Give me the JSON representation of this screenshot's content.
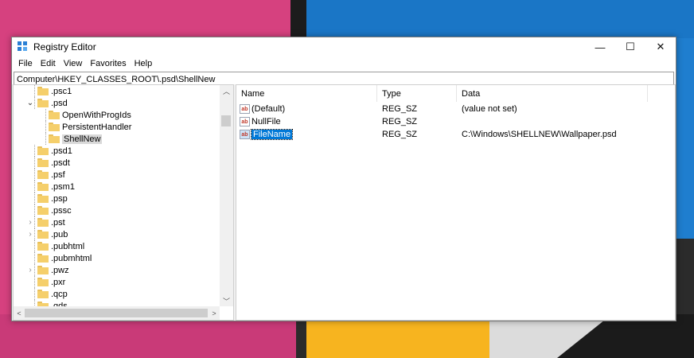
{
  "window": {
    "title": "Registry Editor",
    "controls": {
      "minimize": "—",
      "maximize": "☐",
      "close": "✕"
    }
  },
  "menu": [
    "File",
    "Edit",
    "View",
    "Favorites",
    "Help"
  ],
  "address": "Computer\\HKEY_CLASSES_ROOT\\.psd\\ShellNew",
  "tree": [
    {
      "label": ".psc1",
      "indent": 0,
      "expander": ""
    },
    {
      "label": ".psd",
      "indent": 0,
      "expander": "open"
    },
    {
      "label": "OpenWithProgIds",
      "indent": 1,
      "expander": ""
    },
    {
      "label": "PersistentHandler",
      "indent": 1,
      "expander": ""
    },
    {
      "label": "ShellNew",
      "indent": 1,
      "expander": "",
      "selected": true
    },
    {
      "label": ".psd1",
      "indent": 0,
      "expander": ""
    },
    {
      "label": ".psdt",
      "indent": 0,
      "expander": ""
    },
    {
      "label": ".psf",
      "indent": 0,
      "expander": ""
    },
    {
      "label": ".psm1",
      "indent": 0,
      "expander": ""
    },
    {
      "label": ".psp",
      "indent": 0,
      "expander": ""
    },
    {
      "label": ".pssc",
      "indent": 0,
      "expander": ""
    },
    {
      "label": ".pst",
      "indent": 0,
      "expander": "closed"
    },
    {
      "label": ".pub",
      "indent": 0,
      "expander": "closed"
    },
    {
      "label": ".pubhtml",
      "indent": 0,
      "expander": ""
    },
    {
      "label": ".pubmhtml",
      "indent": 0,
      "expander": ""
    },
    {
      "label": ".pwz",
      "indent": 0,
      "expander": "closed"
    },
    {
      "label": ".pxr",
      "indent": 0,
      "expander": ""
    },
    {
      "label": ".qcp",
      "indent": 0,
      "expander": ""
    },
    {
      "label": ".qds",
      "indent": 0,
      "expander": ""
    }
  ],
  "columns": {
    "name": "Name",
    "type": "Type",
    "data": "Data"
  },
  "values": [
    {
      "name": "(Default)",
      "type": "REG_SZ",
      "data": "(value not set)",
      "icon": "ab"
    },
    {
      "name": "NullFile",
      "type": "REG_SZ",
      "data": "",
      "icon": "ab"
    },
    {
      "name": "FileName",
      "type": "REG_SZ",
      "data": "C:\\Windows\\SHELLNEW\\Wallpaper.psd",
      "icon": "ab",
      "selected": true
    }
  ],
  "colors": {
    "selection": "#0078d7",
    "folder": "#f5cf6b",
    "tree_selection": "#d9d9d9"
  }
}
